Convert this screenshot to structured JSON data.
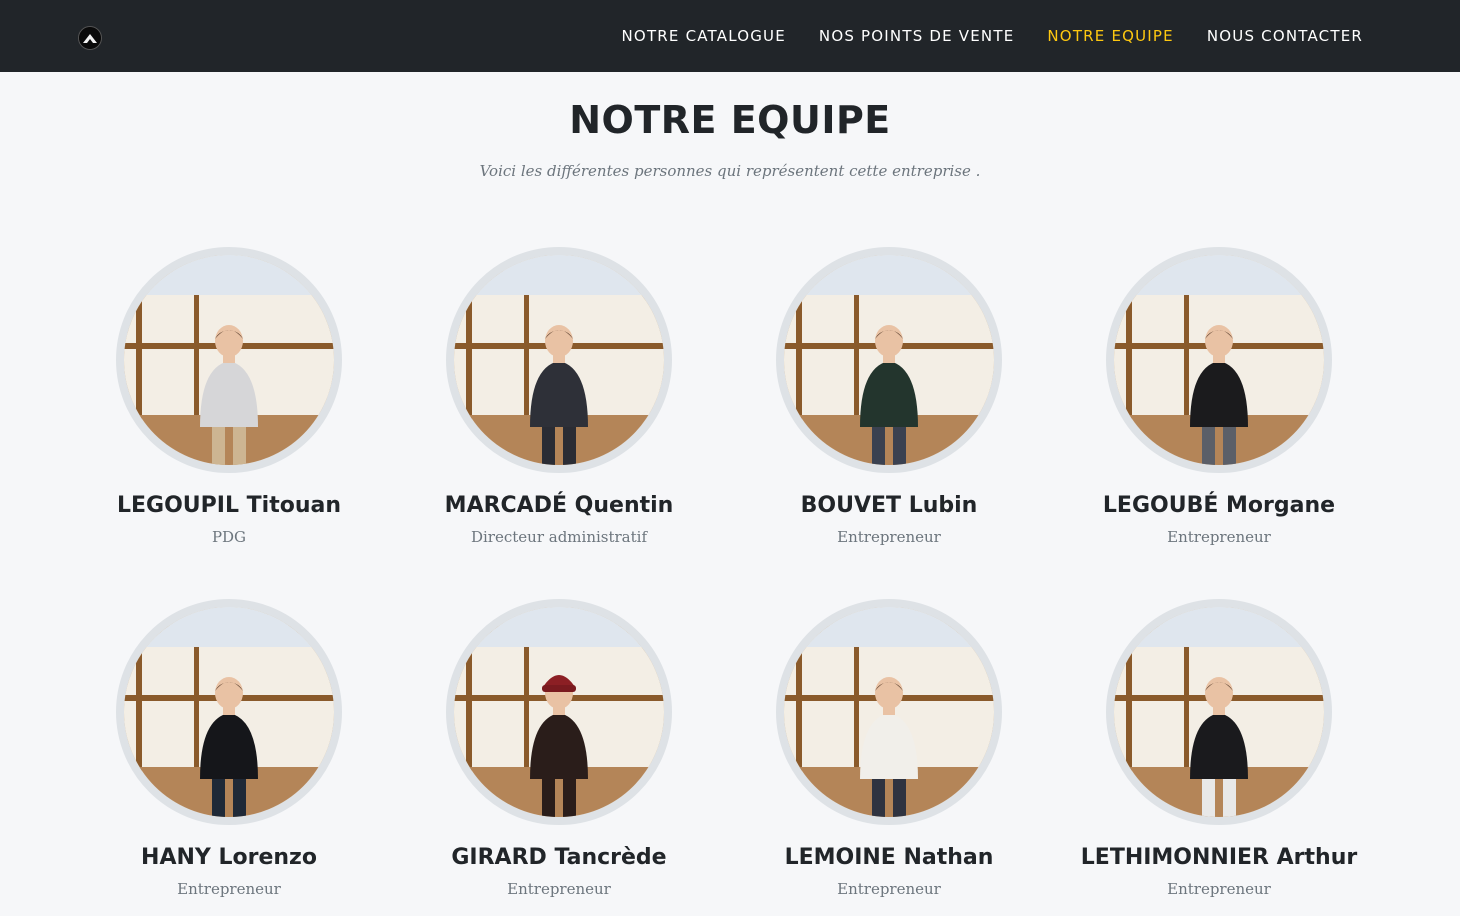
{
  "brand": {
    "logo_icon": "mountain-logo-icon"
  },
  "nav": {
    "items": [
      {
        "label": "NOTRE CATALOGUE",
        "active": false
      },
      {
        "label": "NOS POINTS DE VENTE",
        "active": false
      },
      {
        "label": "NOTRE EQUIPE",
        "active": true
      },
      {
        "label": "NOUS CONTACTER",
        "active": false
      }
    ]
  },
  "section": {
    "title": "NOTRE EQUIPE",
    "subtitle": "Voici les différentes personnes qui représentent cette entreprise ."
  },
  "team": [
    {
      "name": "LEGOUPIL Titouan",
      "role": "PDG",
      "top_color": "#d6d6d8",
      "bottom_color": "#cdb592",
      "has_hat": false
    },
    {
      "name": "MARCADÉ Quentin",
      "role": "Directeur administratif",
      "top_color": "#2e3038",
      "bottom_color": "#2a2c34",
      "has_hat": false
    },
    {
      "name": "BOUVET Lubin",
      "role": "Entrepreneur",
      "top_color": "#23352d",
      "bottom_color": "#3a4150",
      "has_hat": false
    },
    {
      "name": "LEGOUBÉ Morgane",
      "role": "Entrepreneur",
      "top_color": "#1b1b1d",
      "bottom_color": "#5b5f68",
      "has_hat": false
    },
    {
      "name": "HANY Lorenzo",
      "role": "Entrepreneur",
      "top_color": "#15161a",
      "bottom_color": "#1f2937",
      "has_hat": false
    },
    {
      "name": "GIRARD Tancrède",
      "role": "Entrepreneur",
      "top_color": "#2a1d1a",
      "bottom_color": "#2a1d1a",
      "has_hat": true
    },
    {
      "name": "LEMOINE Nathan",
      "role": "Entrepreneur",
      "top_color": "#f1efea",
      "bottom_color": "#2f3340",
      "has_hat": false
    },
    {
      "name": "LETHIMONNIER Arthur",
      "role": "Entrepreneur",
      "top_color": "#1a1a1d",
      "bottom_color": "#e8e8e8",
      "has_hat": false
    }
  ],
  "colors": {
    "navbar_bg": "#212529",
    "nav_active": "#fec810",
    "page_bg": "#f6f7f9",
    "photo_ring": "#dee2e6",
    "wall": "#f3eee5",
    "beam": "#8a5a2b",
    "floor": "#b48558",
    "skin": "#e9c2a4",
    "hair": "#4a3222"
  }
}
